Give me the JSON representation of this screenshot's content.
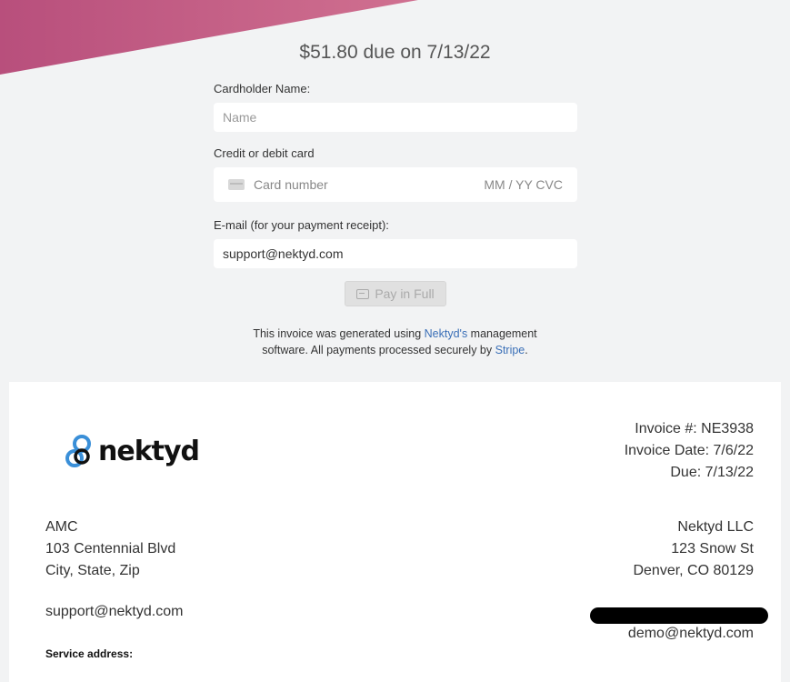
{
  "header": {
    "due_text": "$51.80 due on 7/13/22"
  },
  "form": {
    "name_label": "Cardholder Name:",
    "name_placeholder": "Name",
    "card_label": "Credit or debit card",
    "card_placeholder": "Card number",
    "card_exp_cvc": "MM / YY  CVC",
    "email_label": "E-mail (for your payment receipt):",
    "email_value": "support@nektyd.com",
    "pay_button": "Pay in Full"
  },
  "note": {
    "line1_prefix": "This invoice was generated using ",
    "nektyd_link": "Nektyd's",
    "line1_suffix": " management",
    "line2_prefix": "software. All payments processed securely by ",
    "stripe_link": "Stripe",
    "line2_suffix": "."
  },
  "invoice": {
    "logo_text": "nektyd",
    "number": "Invoice #: NE3938",
    "date": "Invoice Date: 7/6/22",
    "due": "Due: 7/13/22",
    "bill_to": {
      "name": "AMC",
      "address1": "103 Centennial Blvd",
      "address2": "City, State, Zip",
      "email": "support@nektyd.com"
    },
    "service_address_label": "Service address:",
    "from": {
      "name": "Nektyd LLC",
      "address1": "123 Snow St",
      "address2": "Denver, CO 80129",
      "email": "demo@nektyd.com"
    }
  },
  "colors": {
    "banner": "#c45f86",
    "link": "#3a6fb7",
    "logo_blue": "#3a8fd8"
  }
}
